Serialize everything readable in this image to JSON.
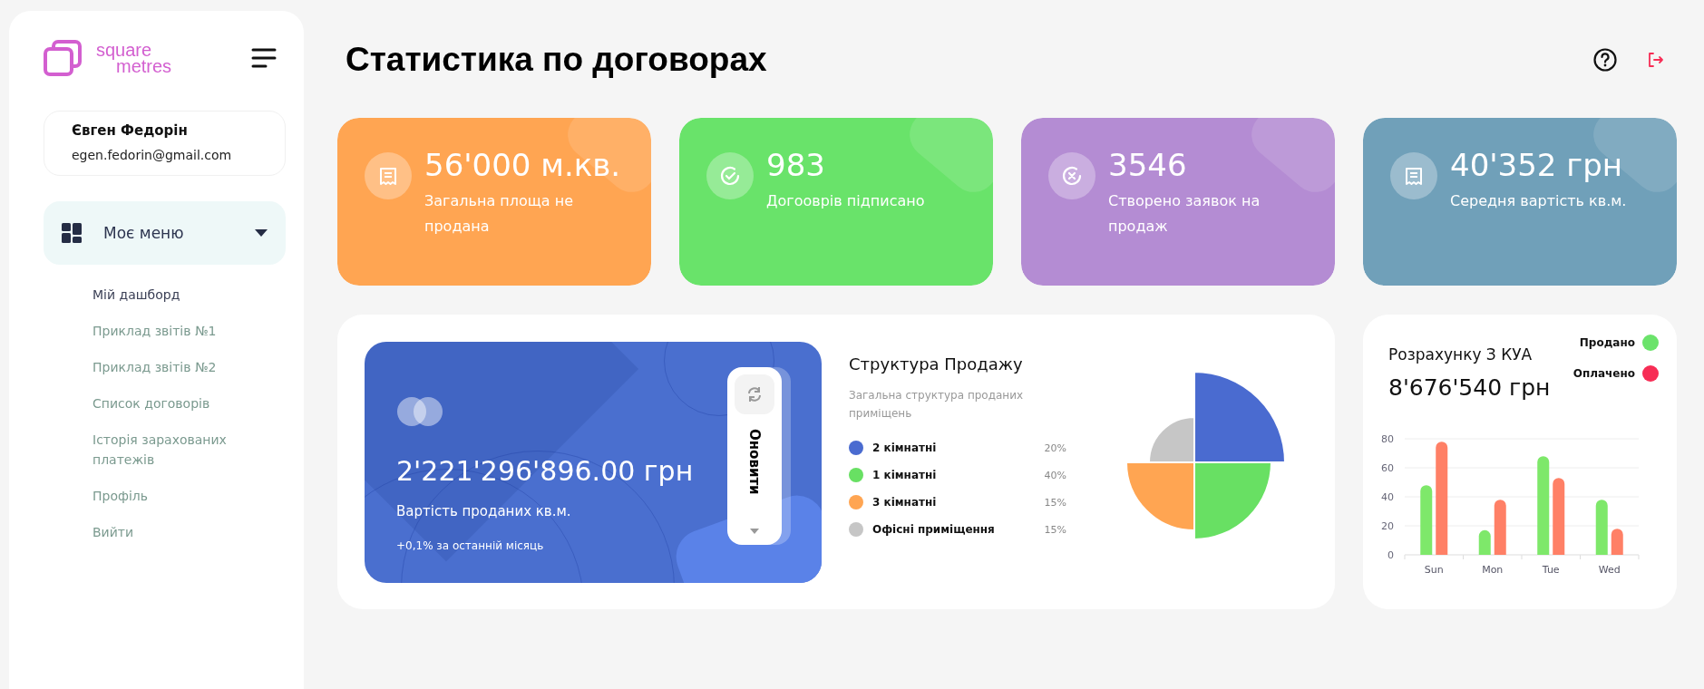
{
  "sidebar": {
    "logo": {
      "line_1": "square",
      "line_2": "metres"
    },
    "user": {
      "name": "Євген Федорін",
      "email": "egen.fedorin@gmail.com"
    },
    "menu": {
      "label": "Моє меню",
      "expanded": true,
      "items": [
        {
          "label": "Мій дашборд",
          "selected": true
        },
        {
          "label": "Приклад звітів №1",
          "selected": false
        },
        {
          "label": "Приклад звітів №2",
          "selected": false
        },
        {
          "label": "Список договорів",
          "selected": false
        },
        {
          "label": "Історія зарахованих платежів",
          "selected": false
        },
        {
          "label": "Профіль",
          "selected": false
        },
        {
          "label": "Вийти",
          "selected": false
        }
      ]
    }
  },
  "page": {
    "title": "Статистика по договорах"
  },
  "stat_cards": [
    {
      "kind": "receipt",
      "value": "56'000 м.кв.",
      "label": "Загальна площа не продана",
      "color": "#ffa552"
    },
    {
      "kind": "check",
      "value": "983",
      "label": "Догооврів підписано",
      "color": "#69e36a"
    },
    {
      "kind": "cross",
      "value": "3546",
      "label": "Створено заявок на продаж",
      "color": "#b48cd3"
    },
    {
      "kind": "receipt",
      "value": "40'352 грн",
      "label": "Середня вартість кв.м.",
      "color": "#70a0b9"
    }
  ],
  "sales_card": {
    "amount": "2'221'296'896.00 грн",
    "label": "Вартість проданих кв.м.",
    "change": "+0,1% за останній місяць",
    "refresh_button": "Оновити"
  },
  "sales_structure": {
    "title": "Структура Продажу",
    "subtitle": "Загальна структура проданих приміщень",
    "items": [
      {
        "label": "2 кімнатні",
        "percent": "20%",
        "color": "#4a6bd0"
      },
      {
        "label": "1 кімнатні",
        "percent": "40%",
        "color": "#68e063"
      },
      {
        "label": "3 кімнатні",
        "percent": "15%",
        "color": "#ffa552"
      },
      {
        "label": "Офісні приміщення",
        "percent": "15%",
        "color": "#c6c6c6"
      }
    ]
  },
  "kua": {
    "title": "Розрахунку З КУА",
    "amount": "8'676'540 грн",
    "legend": [
      {
        "color": "#6be36b"
      },
      {
        "color": "#f72d55"
      }
    ],
    "chart_data": {
      "type": "bar",
      "categories": [
        "Sun",
        "Mon",
        "Tue",
        "Wed"
      ],
      "series": [
        {
          "name": "Продано",
          "color": "#7ee86a",
          "values": [
            48,
            17,
            68,
            38
          ]
        },
        {
          "name": "Оплачено",
          "color": "#ff8066",
          "values": [
            78,
            38,
            53,
            18
          ]
        }
      ],
      "ylim": [
        0,
        80
      ],
      "yticks": [
        0,
        20,
        40,
        60,
        80
      ],
      "grid": true
    }
  }
}
